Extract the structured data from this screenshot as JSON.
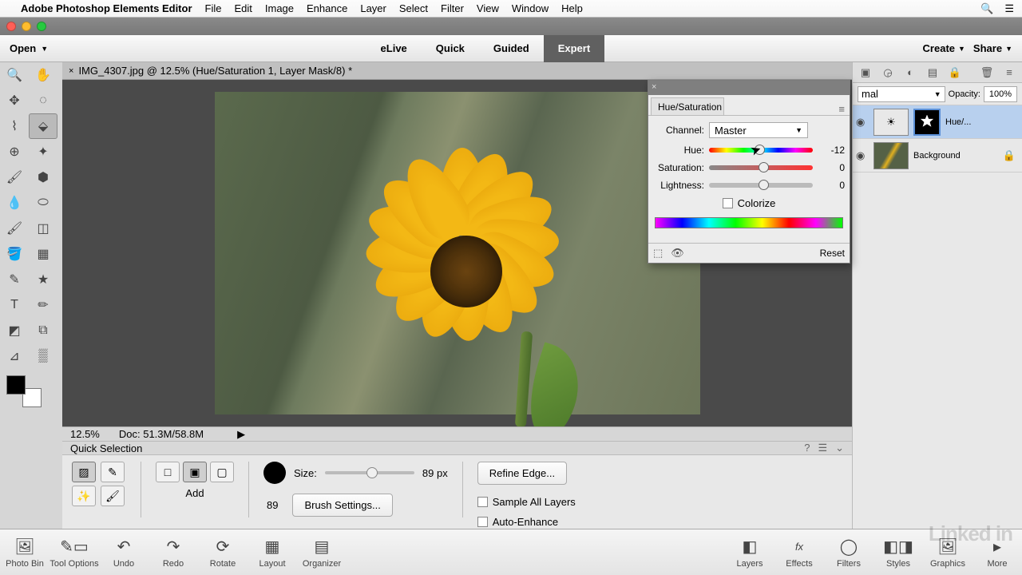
{
  "menubar": {
    "app_name": "Adobe Photoshop Elements Editor",
    "items": [
      "File",
      "Edit",
      "Image",
      "Enhance",
      "Layer",
      "Select",
      "Filter",
      "View",
      "Window",
      "Help"
    ]
  },
  "appbar": {
    "open_label": "Open",
    "tabs": [
      "eLive",
      "Quick",
      "Guided",
      "Expert"
    ],
    "active_tab": 3,
    "create_label": "Create",
    "share_label": "Share"
  },
  "doc": {
    "title": "IMG_4307.jpg @ 12.5% (Hue/Saturation 1, Layer Mask/8) *"
  },
  "status": {
    "zoom": "12.5%",
    "doc_info": "Doc: 51.3M/58.8M"
  },
  "options": {
    "title": "Quick Selection",
    "add_label": "Add",
    "size_label": "Size:",
    "size_display": "89 px",
    "size_value": "89",
    "brush_settings_label": "Brush Settings...",
    "refine_label": "Refine Edge...",
    "sample_all_label": "Sample All Layers",
    "auto_enhance_label": "Auto-Enhance"
  },
  "right_panel": {
    "blend_mode": "mal",
    "opacity_label": "Opacity:",
    "opacity_value": "100%",
    "layer1_name": "Hue/...",
    "layer2_name": "Background"
  },
  "hs": {
    "title": "Hue/Saturation",
    "channel_label": "Channel:",
    "channel_value": "Master",
    "hue_label": "Hue:",
    "hue_value": "-12",
    "sat_label": "Saturation:",
    "sat_value": "0",
    "lig_label": "Lightness:",
    "lig_value": "0",
    "colorize_label": "Colorize",
    "reset_label": "Reset"
  },
  "bottom": {
    "left": [
      "Photo Bin",
      "Tool Options",
      "Undo",
      "Redo",
      "Rotate",
      "Layout",
      "Organizer"
    ],
    "right": [
      "Layers",
      "Effects",
      "Filters",
      "Styles",
      "Graphics",
      "More"
    ]
  }
}
